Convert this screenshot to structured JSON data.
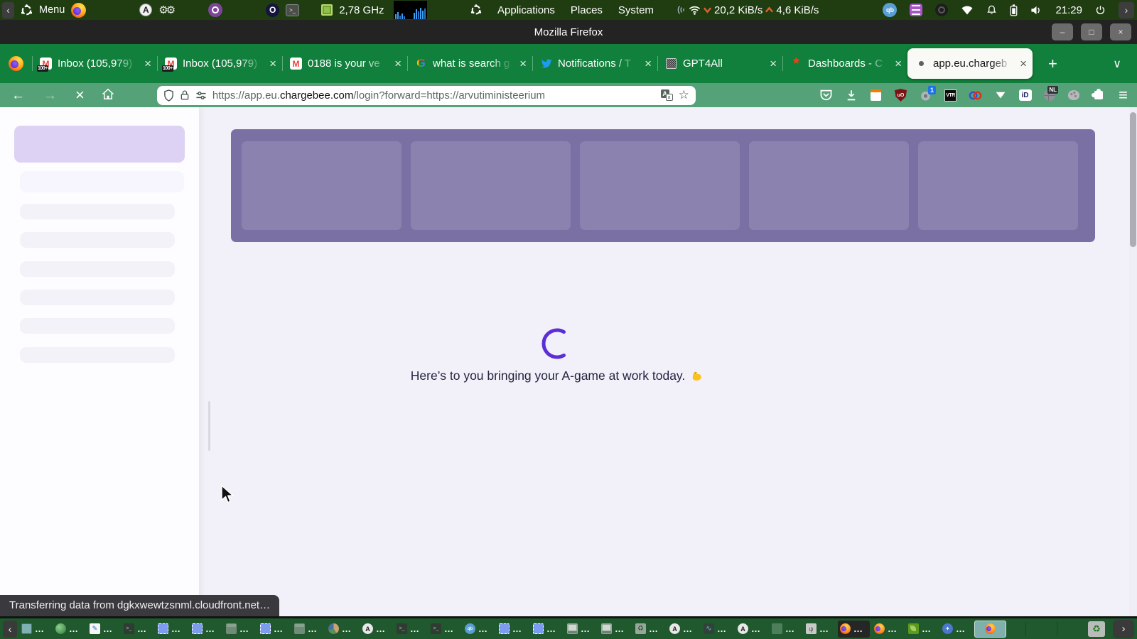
{
  "colors": {
    "accent_purple": "#5c2ed6",
    "firefox_theme_green_dark": "#11803c",
    "firefox_theme_green_light": "#56a278",
    "banner_purple": "#7b70a3",
    "card_purple": "#8c82af"
  },
  "icons": {
    "chevron_left": "‹",
    "chevron_right": "›",
    "minimize": "–",
    "maximize": "□",
    "close": "×",
    "new_tab": "+",
    "tab_overflow": "∨",
    "tab_close": "×",
    "back": "←",
    "forward": "→",
    "stop": "×",
    "star": "☆",
    "menu": "≡",
    "ellipsis": "…",
    "recycle": "♻",
    "gmail_m": "M",
    "google_g": "G",
    "chargebee_mark": "*",
    "opera_o": "O",
    "terminal_glyph": ">_",
    "search_a": "A",
    "qb": "qb",
    "gears": "⚙⚙",
    "ublock_text": "uO",
    "vtr_text": "VTR",
    "ideal_text": "iD",
    "nl_text": "NL",
    "ext_badge_one": "1",
    "translate_a": "A",
    "translate_b": "a"
  },
  "system_bar": {
    "menu_label": "Menu",
    "cpu_freq": "2,78 GHz",
    "menus": [
      "Applications",
      "Places",
      "System"
    ],
    "net_down": "20,2 KiB/s",
    "net_up": "4,6 KiB/s",
    "clock": "21:29"
  },
  "title_bar": {
    "title": "Mozilla Firefox"
  },
  "tab_bar": {
    "tabs": [
      {
        "label": "Inbox (105,979)",
        "classes": "gmail badged",
        "badge": "100+"
      },
      {
        "label": "Inbox (105,979)",
        "classes": "gmail badged",
        "badge": "100+"
      },
      {
        "label": "0188 is your ve",
        "classes": "gmail"
      },
      {
        "label": "what is search g",
        "classes": "google"
      },
      {
        "label": "Notifications / T",
        "classes": "twitter"
      },
      {
        "label": "GPT4All",
        "classes": "gpt4all"
      },
      {
        "label": "Dashboards - C",
        "classes": "chargebee"
      },
      {
        "label": "app.eu.chargeb",
        "classes": "dotfav active"
      }
    ]
  },
  "nav_bar": {
    "url_prefix": "https://app.eu.",
    "url_domain": "chargebee.com",
    "url_path": "/login?forward=https://arvutiministeerium"
  },
  "main": {
    "loading_message": "Here’s to you bringing your A-game at work today.",
    "loading_emoji": "💪",
    "banner_cards": 5,
    "sidebar_skeleton_rows": 6
  },
  "status_tooltip": {
    "text": "Transferring data from dgkxwewtzsnml.cloudfront.net…"
  },
  "taskbar": {
    "items": [
      {
        "type": "window"
      },
      {
        "type": "globe"
      },
      {
        "type": "edit"
      },
      {
        "type": "terminal"
      },
      {
        "type": "shot"
      },
      {
        "type": "shot"
      },
      {
        "type": "folder"
      },
      {
        "type": "shot"
      },
      {
        "type": "folder"
      },
      {
        "type": "disk"
      },
      {
        "type": "search"
      },
      {
        "type": "terminal"
      },
      {
        "type": "terminal"
      },
      {
        "type": "qb"
      },
      {
        "type": "shot"
      },
      {
        "type": "shot"
      },
      {
        "type": "laptop"
      },
      {
        "type": "laptop"
      },
      {
        "type": "recycle"
      },
      {
        "type": "search"
      },
      {
        "type": "wave"
      },
      {
        "type": "search"
      },
      {
        "type": "green"
      },
      {
        "type": "usb"
      },
      {
        "type": "firefox",
        "variant": "dark"
      },
      {
        "type": "firefox"
      },
      {
        "type": "leaf"
      },
      {
        "type": "compass"
      },
      {
        "type": "firefox",
        "variant": "active"
      }
    ]
  }
}
